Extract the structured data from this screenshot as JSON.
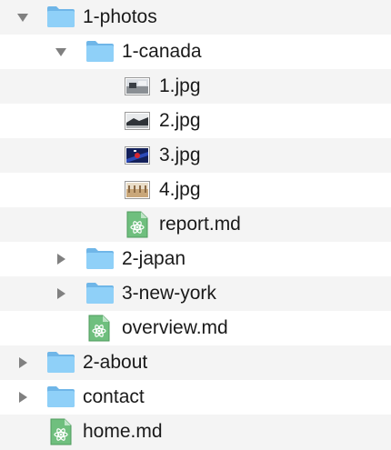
{
  "tree": {
    "rows": [
      {
        "label": "1-photos",
        "kind": "folder",
        "state": "expanded",
        "icon": "folder-icon"
      },
      {
        "label": "1-canada",
        "kind": "folder",
        "state": "expanded",
        "icon": "folder-icon"
      },
      {
        "label": "1.jpg",
        "kind": "image",
        "icon": "image-thumbnail-icon"
      },
      {
        "label": "2.jpg",
        "kind": "image",
        "icon": "image-thumbnail-icon"
      },
      {
        "label": "3.jpg",
        "kind": "image",
        "icon": "image-thumbnail-icon"
      },
      {
        "label": "4.jpg",
        "kind": "image",
        "icon": "image-thumbnail-icon"
      },
      {
        "label": "report.md",
        "kind": "markdown",
        "icon": "markdown-file-icon"
      },
      {
        "label": "2-japan",
        "kind": "folder",
        "state": "collapsed",
        "icon": "folder-icon"
      },
      {
        "label": "3-new-york",
        "kind": "folder",
        "state": "collapsed",
        "icon": "folder-icon"
      },
      {
        "label": "overview.md",
        "kind": "markdown",
        "icon": "markdown-file-icon"
      },
      {
        "label": "2-about",
        "kind": "folder",
        "state": "collapsed",
        "icon": "folder-icon"
      },
      {
        "label": "contact",
        "kind": "folder",
        "state": "collapsed",
        "icon": "folder-icon"
      },
      {
        "label": "home.md",
        "kind": "markdown",
        "icon": "markdown-file-icon"
      }
    ]
  },
  "colors": {
    "folder": "#7ec6f5",
    "folder_tab": "#6fb6e8",
    "markdown_file": "#6fbf7e",
    "row_alt": "#f4f4f4",
    "disclosure": "#808080"
  }
}
